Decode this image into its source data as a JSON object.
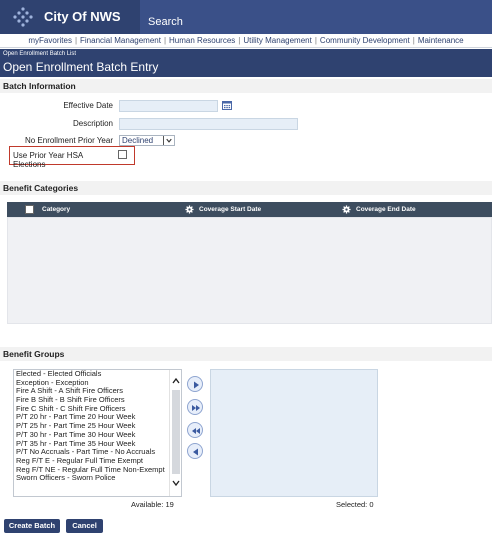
{
  "app": {
    "title": "City Of NWS",
    "logo_icon": "dotted-diamond-logo-icon",
    "search": {
      "value": "Search"
    }
  },
  "nav": {
    "items": [
      "myFavorites",
      "Financial Management",
      "Human Resources",
      "Utility Management",
      "Community Development",
      "Maintenance"
    ]
  },
  "breadcrumb": "Open Enrollment Batch List",
  "page_title": "Open Enrollment Batch Entry",
  "batch_information": {
    "title": "Batch Information",
    "effective_date_label": "Effective Date",
    "effective_date_value": "",
    "description_label": "Description",
    "description_value": "",
    "no_enrollment_label": "No Enrollment Prior Year",
    "no_enrollment_value": "Declined",
    "hsa_label": "Use Prior Year HSA Elections",
    "hsa_checked": false
  },
  "benefit_categories": {
    "title": "Benefit Categories",
    "columns": [
      "Category",
      "Coverage Start Date",
      "Coverage End Date"
    ],
    "rows": []
  },
  "benefit_groups": {
    "title": "Benefit Groups",
    "available": [
      "Elected - Elected Officials",
      "Exception - Exception",
      "Fire A Shift - A Shift Fire Officers",
      "Fire B Shift - B Shift Fire Officers",
      "Fire C Shift - C Shift Fire Officers",
      "P/T 20 hr - Part Time 20 Hour Week",
      "P/T 25 hr - Part Time 25 Hour Week",
      "P/T 30 hr - Part Time 30 Hour Week",
      "P/T 35 hr - Part Time 35 Hour Week",
      "P/T No Accruals - Part Time - No Accruals",
      "Reg F/T E - Regular Full Time Exempt",
      "Reg F/T NE - Regular Full Time Non-Exempt",
      "Sworn Officers - Sworn Police"
    ],
    "selected": [],
    "available_count": "Available: 19",
    "selected_count": "Selected: 0"
  },
  "buttons": {
    "create": "Create Batch",
    "cancel": "Cancel"
  },
  "colors": {
    "brand": "#2f4270",
    "highlight_border": "#c0392b",
    "input_bg": "#e6eef7"
  }
}
